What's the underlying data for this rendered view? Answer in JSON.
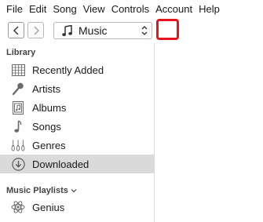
{
  "menubar": {
    "items": [
      "File",
      "Edit",
      "Song",
      "View",
      "Controls",
      "Account",
      "Help"
    ]
  },
  "toolbar": {
    "media_selector": "Music"
  },
  "sidebar": {
    "library_header": "Library",
    "items": [
      {
        "label": "Recently Added",
        "icon": "grid-icon"
      },
      {
        "label": "Artists",
        "icon": "microphone-icon"
      },
      {
        "label": "Albums",
        "icon": "album-icon"
      },
      {
        "label": "Songs",
        "icon": "music-note-icon"
      },
      {
        "label": "Genres",
        "icon": "guitar-icon"
      },
      {
        "label": "Downloaded",
        "icon": "download-icon",
        "selected": true
      }
    ],
    "playlists_header": "Music Playlists",
    "playlists": [
      {
        "label": "Genius",
        "icon": "genius-atom-icon"
      }
    ]
  },
  "colors": {
    "highlight": "#e8141c",
    "selected_bg": "#dadada"
  }
}
